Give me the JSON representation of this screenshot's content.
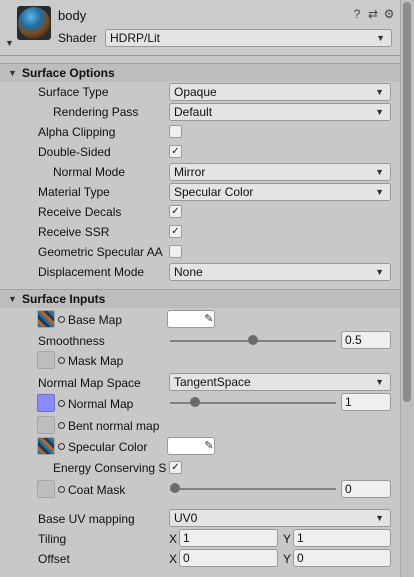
{
  "header": {
    "title": "body",
    "shader_label": "Shader",
    "shader_value": "HDRP/Lit",
    "icons": [
      "help-icon",
      "preset-icon",
      "settings-icon"
    ]
  },
  "surface_options": {
    "title": "Surface Options",
    "surface_type": {
      "label": "Surface Type",
      "value": "Opaque"
    },
    "rendering_pass": {
      "label": "Rendering Pass",
      "value": "Default"
    },
    "alpha_clipping": {
      "label": "Alpha Clipping",
      "checked": false
    },
    "double_sided": {
      "label": "Double-Sided",
      "checked": true
    },
    "normal_mode": {
      "label": "Normal Mode",
      "value": "Mirror"
    },
    "material_type": {
      "label": "Material Type",
      "value": "Specular Color"
    },
    "receive_decals": {
      "label": "Receive Decals",
      "checked": true
    },
    "receive_ssr": {
      "label": "Receive SSR",
      "checked": true
    },
    "geometric_specular_aa": {
      "label": "Geometric Specular AA",
      "checked": false
    },
    "displacement_mode": {
      "label": "Displacement Mode",
      "value": "None"
    }
  },
  "surface_inputs": {
    "title": "Surface Inputs",
    "base_map": {
      "label": "Base Map"
    },
    "smoothness": {
      "label": "Smoothness",
      "value": "0.5",
      "fraction": 0.5
    },
    "mask_map": {
      "label": "Mask Map"
    },
    "normal_map_space": {
      "label": "Normal Map Space",
      "value": "TangentSpace"
    },
    "normal_map": {
      "label": "Normal Map",
      "value": "1",
      "fraction": 0.125
    },
    "bent_normal_map": {
      "label": "Bent normal map"
    },
    "specular_color": {
      "label": "Specular Color"
    },
    "energy_conserving": {
      "label": "Energy Conserving S",
      "checked": true
    },
    "coat_mask": {
      "label": "Coat Mask",
      "value": "0",
      "fraction": 0
    },
    "base_uv_mapping": {
      "label": "Base UV mapping",
      "value": "UV0"
    },
    "tiling": {
      "label": "Tiling",
      "x_label": "X",
      "x": "1",
      "y_label": "Y",
      "y": "1"
    },
    "offset": {
      "label": "Offset",
      "x_label": "X",
      "x": "0",
      "y_label": "Y",
      "y": "0"
    }
  },
  "glyphs": {
    "check": "✓",
    "dropdown_arrow": "▼",
    "foldout": "▼",
    "picker": "✎"
  }
}
